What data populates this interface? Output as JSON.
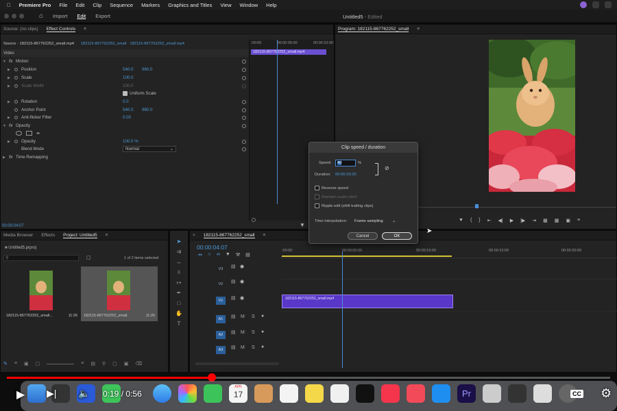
{
  "menubar": {
    "app": "Premiere Pro",
    "items": [
      "File",
      "Edit",
      "Clip",
      "Sequence",
      "Markers",
      "Graphics and Titles",
      "View",
      "Window",
      "Help"
    ]
  },
  "header": {
    "tabs": [
      "Import",
      "Edit",
      "Export"
    ],
    "active_tab": "Edit",
    "doc_title": "Untitled5",
    "doc_status": " - Edited"
  },
  "effect_controls": {
    "source_tab": "Source: (no clips)",
    "tab": "Effect Controls",
    "source_line": "Source · 182115-867762252_small.mp4",
    "sequence_line": "182115-867762252_small · 182115-867762252_small.mp4",
    "mini_timecodes": [
      ":00:00",
      "00:00:05:00",
      "00:00:10:00"
    ],
    "mini_clip": "182115-867762252_small.mp4",
    "section_video": "Video",
    "motion": "Motion",
    "position_label": "Position",
    "position_x": "540.0",
    "position_y": "960.0",
    "scale_label": "Scale",
    "scale_val": "100.0",
    "scale_width_label": "Scale Width",
    "scale_width_val": "100.0",
    "uniform_scale": "Uniform Scale",
    "rotation_label": "Rotation",
    "rotation_val": "0.0",
    "anchor_label": "Anchor Point",
    "anchor_x": "540.0",
    "anchor_y": "960.0",
    "antiflicker_label": "Anti-flicker Filter",
    "antiflicker_val": "0.00",
    "opacity_section": "Opacity",
    "opacity_label": "Opacity",
    "opacity_val": "100.0 %",
    "blend_label": "Blend Mode",
    "blend_val": "Normal",
    "time_remap": "Time Remapping",
    "timecode": "00:00:04:07"
  },
  "program": {
    "title": "Program: 182115-867762252_small"
  },
  "project": {
    "tabs": [
      "Media Browser",
      "Effects",
      "Project: Untitled5"
    ],
    "active_tab": "Project: Untitled5",
    "file": "Untitled5.prproj",
    "selected_count": "1 of 2 items selected",
    "items": [
      {
        "name": "182115-867762252_small...",
        "duration": "11:26"
      },
      {
        "name": "182115-867762252_small.",
        "duration": "11:26"
      }
    ]
  },
  "timeline": {
    "tab": "182115-867762252_small",
    "timecode": "00:00:04:07",
    "ruler": [
      ":00:00",
      "00:00:05:00",
      "00:00:10:00",
      "00:00:15:00",
      "00:00:20:00"
    ],
    "tracks": [
      "V3",
      "V2",
      "V1",
      "A1",
      "A2",
      "A3"
    ],
    "clip": "182115-867762252_small.mp4"
  },
  "dialog": {
    "title": "Clip speed / duration",
    "speed_label": "Speed:",
    "speed_value": "40",
    "speed_unit": "%",
    "duration_label": "Duration:",
    "duration_value": "00:00:29:20",
    "reverse": "Reverse speed",
    "maintain_audio": "Maintain audio pitch",
    "ripple": "Ripple edit (shift trailing clips)",
    "interp_label": "Time interpolation:",
    "interp_value": "Frame sampling",
    "cancel": "Cancel",
    "ok": "OK"
  },
  "player": {
    "current": "0:19",
    "separator": "/",
    "total": "0:56",
    "progress": 0.34,
    "cc": "CC"
  },
  "dock": {
    "calendar_month": "APR",
    "calendar_day": "17"
  },
  "colors": {
    "accent_blue": "#4d9ad8",
    "clip_purple": "#5937c8",
    "youtube_red": "#ff0000"
  }
}
